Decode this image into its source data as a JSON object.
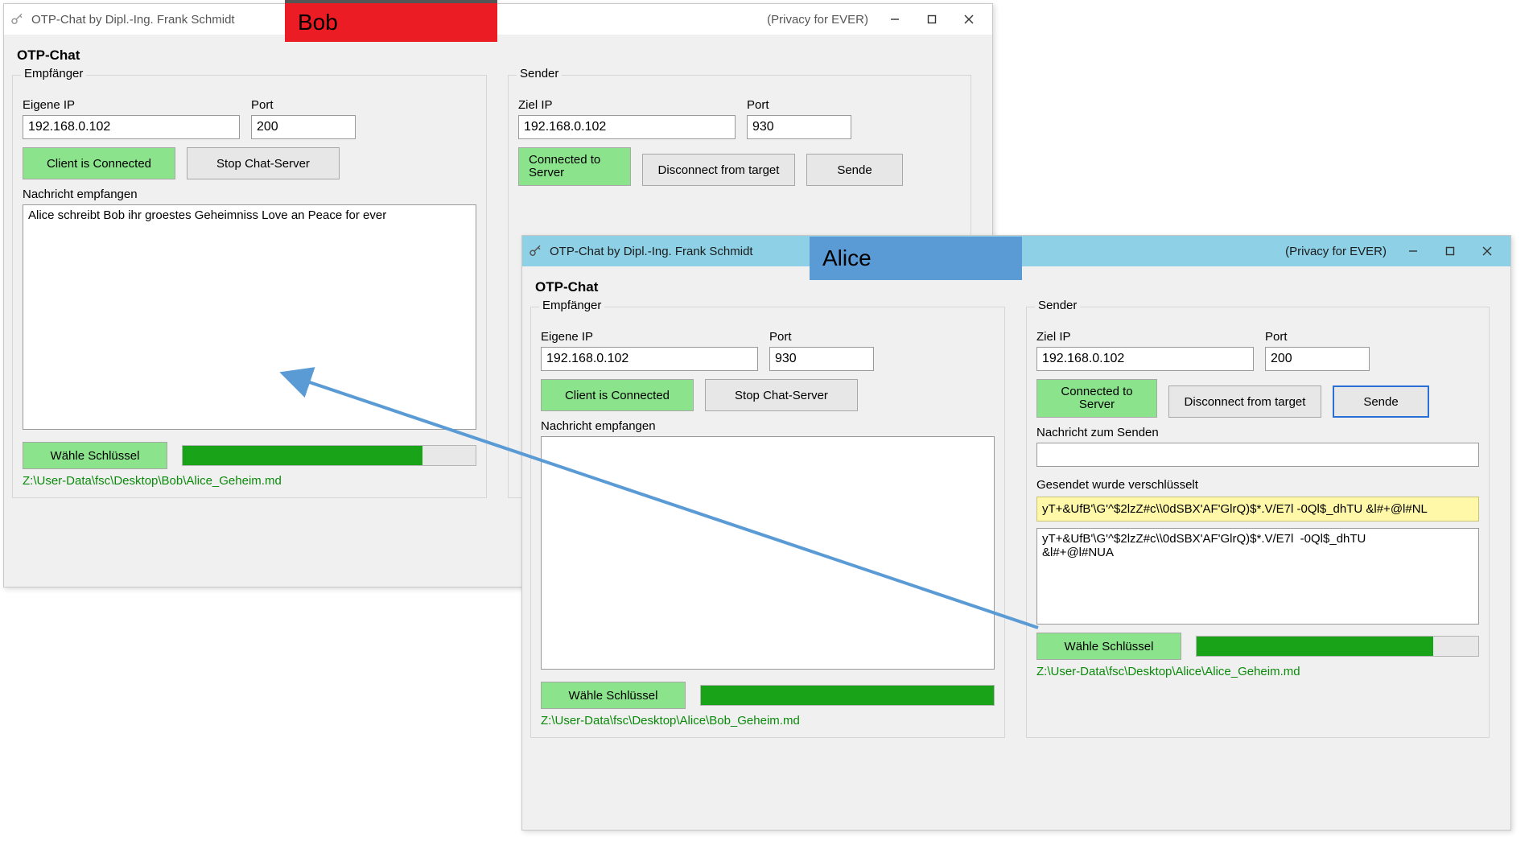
{
  "common": {
    "titlebar_text": "OTP-Chat by Dipl.-Ing. Frank Schmidt",
    "titlebar_right": "(Privacy for EVER)",
    "app_heading": "OTP-Chat",
    "legend_recv": "Empfänger",
    "legend_send": "Sender",
    "label_own_ip": "Eigene IP",
    "label_target_ip": "Ziel IP",
    "label_port": "Port",
    "btn_client_connected": "Client is Connected",
    "btn_stop_server": "Stop Chat-Server",
    "btn_connected_server": "Connected to Server",
    "btn_disconnect": "Disconnect from target",
    "btn_send": "Sende",
    "label_msg_recv": "Nachricht empfangen",
    "label_msg_send": "Nachricht zum Senden",
    "label_sent_encrypted": "Gesendet wurde verschlüsselt",
    "btn_choose_key": "Wähle Schlüssel"
  },
  "tags": {
    "bob": "Bob",
    "alice": "Alice"
  },
  "bob": {
    "recv_ip": "192.168.0.102",
    "recv_port": "200",
    "send_ip": "192.168.0.102",
    "send_port": "930",
    "received_msg": "Alice schreibt Bob ihr groestes Geheimniss Love an Peace for ever",
    "key_path": "Z:\\User-Data\\fsc\\Desktop\\Bob\\Alice_Geheim.md",
    "progress_pct": 82
  },
  "alice": {
    "recv_ip": "192.168.0.102",
    "recv_port": "930",
    "send_ip": "192.168.0.102",
    "send_port": "200",
    "received_msg": "",
    "send_msg": "",
    "encrypted_line": "yT+&UfB'\\G'^$2lzZ#c\\\\0dSBX'AF'GlrQ)$*.V/E7l  -0Ql$_dhTU &l#+@l#NL",
    "raw_block": "yT+&UfB'\\G'^$2lzZ#c\\\\0dSBX'AF'GlrQ)$*.V/E7l  -0Ql$_dhTU\n&l#+@l#NUA",
    "recv_key_path": "Z:\\User-Data\\fsc\\Desktop\\Alice\\Bob_Geheim.md",
    "send_key_path": "Z:\\User-Data\\fsc\\Desktop\\Alice\\Alice_Geheim.md",
    "recv_progress_pct": 100,
    "send_progress_pct": 84
  }
}
